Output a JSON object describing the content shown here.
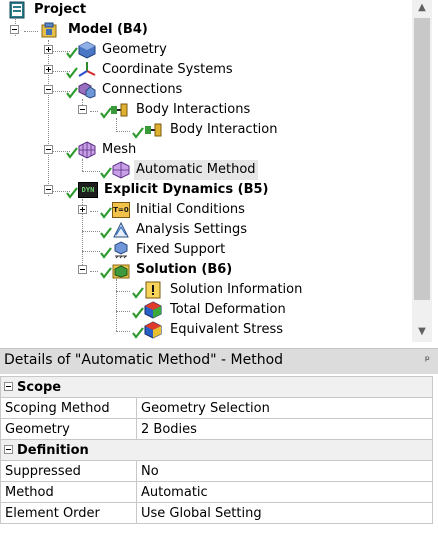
{
  "tree": {
    "project": {
      "label": "Project",
      "icon": "project-icon"
    },
    "model": {
      "label": "Model (B4)",
      "icon": "model-icon"
    },
    "geometry": {
      "label": "Geometry",
      "icon": "geometry-icon"
    },
    "coordinate_systems": {
      "label": "Coordinate Systems",
      "icon": "coordinate-systems-icon"
    },
    "connections": {
      "label": "Connections",
      "icon": "connections-icon"
    },
    "body_interactions": {
      "label": "Body Interactions",
      "icon": "body-interactions-icon"
    },
    "body_interaction": {
      "label": "Body Interaction",
      "icon": "body-interaction-icon"
    },
    "mesh": {
      "label": "Mesh",
      "icon": "mesh-icon"
    },
    "automatic_method": {
      "label": "Automatic Method",
      "icon": "automatic-method-icon",
      "selected": true
    },
    "explicit_dynamics": {
      "label": "Explicit Dynamics (B5)",
      "icon": "explicit-dynamics-icon",
      "badge": "DYN"
    },
    "initial_conditions": {
      "label": "Initial Conditions",
      "icon": "initial-conditions-icon",
      "badge": "T=0"
    },
    "analysis_settings": {
      "label": "Analysis Settings",
      "icon": "analysis-settings-icon"
    },
    "fixed_support": {
      "label": "Fixed Support",
      "icon": "fixed-support-icon"
    },
    "solution": {
      "label": "Solution (B6)",
      "icon": "solution-icon"
    },
    "solution_information": {
      "label": "Solution Information",
      "icon": "solution-information-icon"
    },
    "total_deformation": {
      "label": "Total Deformation",
      "icon": "total-deformation-icon"
    },
    "equivalent_stress": {
      "label": "Equivalent Stress",
      "icon": "equivalent-stress-icon"
    }
  },
  "details": {
    "title": "Details of \"Automatic Method\" - Method",
    "pin_glyph": "ᵖ",
    "sections": {
      "scope": {
        "label": "Scope",
        "rows": [
          {
            "label": "Scoping Method",
            "value": "Geometry Selection"
          },
          {
            "label": "Geometry",
            "value": "2 Bodies"
          }
        ]
      },
      "definition": {
        "label": "Definition",
        "rows": [
          {
            "label": "Suppressed",
            "value": "No"
          },
          {
            "label": "Method",
            "value": "Automatic"
          },
          {
            "label": "Element Order",
            "value": "Use Global Setting"
          }
        ]
      }
    }
  },
  "colors": {
    "check": "#2f9b2f",
    "selected_bg": "#e6e6e6",
    "section_bg": "#f0f0f0",
    "header_bg": "#dcdcdc"
  }
}
